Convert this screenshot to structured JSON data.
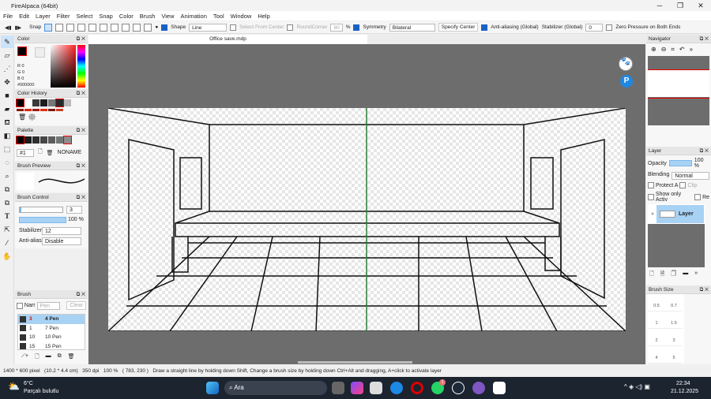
{
  "window": {
    "title": "FireAlpaca (64bit)",
    "minimize": "─",
    "maximize": "❐",
    "close": "✕"
  },
  "menu": [
    "File",
    "Edit",
    "Layer",
    "Filter",
    "Select",
    "Snap",
    "Color",
    "Brush",
    "View",
    "Animation",
    "Tool",
    "Window",
    "Help"
  ],
  "toolbar": {
    "snap_label": "Snap",
    "shape_label": "Shape",
    "shape_value": "Line",
    "select_from_center": "Select From Center",
    "round_corner": "RoundCorner",
    "round_corner_value": "80",
    "percent": "%",
    "symmetry_label": "Symmetry",
    "symmetry_value": "Bilateral",
    "specify_center": "Specify Center",
    "antialiasing": "Anti-aliasing (Global)",
    "stabilizer_label": "Stabilizer (Global)",
    "stabilizer_value": "0",
    "zero_pressure": "Zero Pressure on Both Ends"
  },
  "document": {
    "tab": "Office save.mdp"
  },
  "color_panel": {
    "title": "Color",
    "r": "R",
    "g": "G",
    "b": "B",
    "r_val": "0",
    "g_val": "0",
    "b_val": "0",
    "hex": "#000000"
  },
  "color_history": {
    "title": "Color History",
    "colors": [
      "#000000",
      "#ffffff",
      "#3a3a3a",
      "#1e1e1e",
      "#777777",
      "#2a2a2a",
      "#bbbbbb"
    ],
    "accents": [
      "#8b1a0a",
      "#d62a10",
      "#a01a10",
      "#e03010",
      "#7a1a10",
      "#c84020"
    ]
  },
  "palette": {
    "title": "Palette",
    "colors": [
      "#000000",
      "#1a1a1a",
      "#2e2e2e",
      "#464646",
      "#5c5c5c",
      "#747474",
      "#8c8c8c"
    ],
    "set": "#1",
    "name": "NONAME"
  },
  "brush_preview": {
    "title": "Brush Preview"
  },
  "brush_control": {
    "title": "Brush Control",
    "size": "3",
    "opacity": "100 %",
    "stabilizer_label": "Stabilizer",
    "stabilizer_value": "12",
    "antialias_label": "Anti-aliasi",
    "antialias_value": "Disable"
  },
  "brush_panel": {
    "title": "Brush",
    "narrow": "Narr",
    "search_placeholder": "Pen",
    "clear": "Clear",
    "items": [
      {
        "size": "3",
        "name": "4 Pen"
      },
      {
        "size": "1",
        "name": "7 Pen"
      },
      {
        "size": "10",
        "name": "10 Pen"
      },
      {
        "size": "15",
        "name": "15 Pen"
      }
    ]
  },
  "navigator": {
    "title": "Navigator"
  },
  "layer_panel": {
    "title": "Layer",
    "opacity_label": "Opacity",
    "opacity_value": "100 %",
    "opacity_fraction": 1.0,
    "blending_label": "Blending",
    "blending_value": "Normal",
    "protect": "Protect A",
    "clip": "Clip",
    "show_only": "Show only Activ",
    "re": "Re",
    "layer_name": "Layer"
  },
  "brush_size": {
    "title": "Brush Size",
    "sizes": [
      "0.5",
      "0.7",
      "1",
      "1.5",
      "2",
      "3",
      "4",
      "5"
    ]
  },
  "status": {
    "size": "1400 * 600 pixel",
    "cm": "(10.2 * 4.4 cm)",
    "dpi": "350 dpi",
    "zoom": "100 %",
    "coords": "( 783, 230 )",
    "hint": "Draw a straight line by holding down Shift, Change a brush size by holding down Ctrl+Alt and dragging, A+click to activate layer"
  },
  "taskbar": {
    "temp": "6°C",
    "weather": "Parçalı bulutlu",
    "search": "Ara",
    "whatsapp_badge": "1",
    "time": "22:34",
    "date": "21.12.2025"
  },
  "colors": {
    "accent": "#1a62c6",
    "canvas_bg": "#6d6d6d",
    "guide": "#2e7d32"
  }
}
